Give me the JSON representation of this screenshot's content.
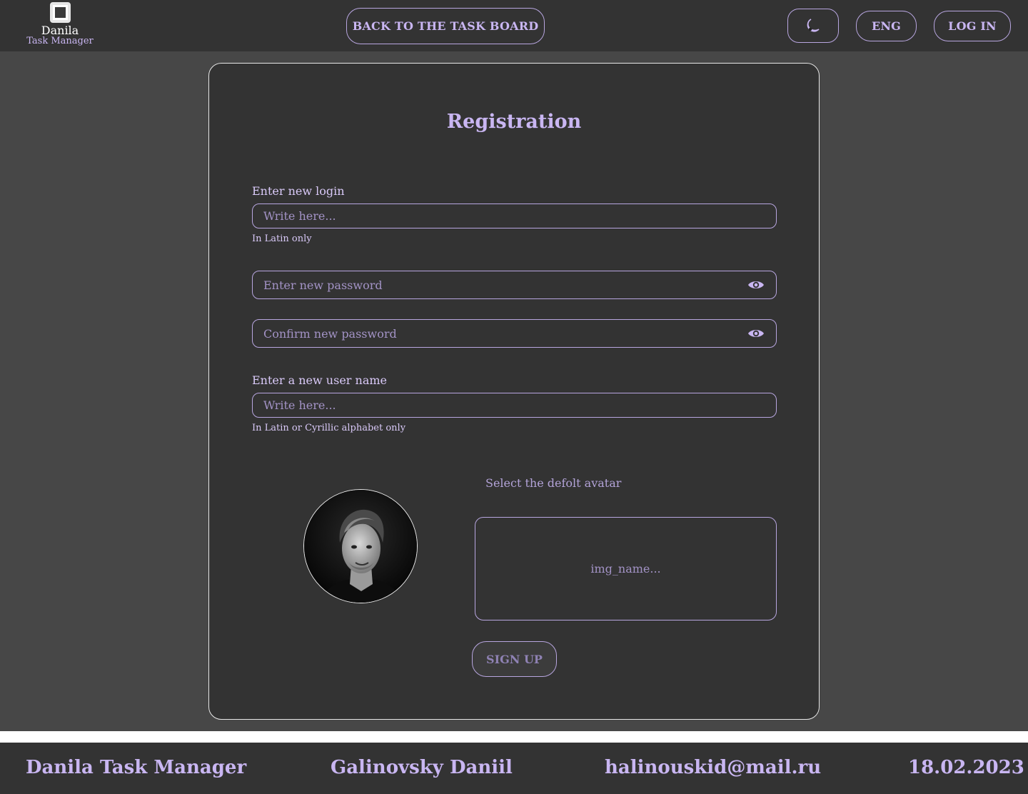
{
  "header": {
    "logo_title": "Danila",
    "logo_subtitle": "Task Manager",
    "back_button": "BACK TO THE TASK BOARD",
    "theme_icon": "moon-icon",
    "lang_button": "ENG",
    "login_button": "LOG IN"
  },
  "form": {
    "title": "Registration",
    "login_label": "Enter new login",
    "login_placeholder": "Write here...",
    "login_hint": "In Latin only",
    "password_placeholder": "Enter new password",
    "confirm_placeholder": "Confirm new password",
    "eye_icon": "eye-icon",
    "username_label": "Enter a new user name",
    "username_placeholder": "Write here...",
    "username_hint": "In Latin or Cyrillic alphabet only",
    "avatar_caption": "Select the defolt avatar",
    "avatar_placeholder": "img_name...",
    "signup_button": "SIGN UP"
  },
  "footer": {
    "app_name": "Danila Task Manager",
    "author": "Galinovsky Daniil",
    "email": "halinouskid@mail.ru",
    "date": "18.02.2023"
  },
  "colors": {
    "accent": "#c9b6f2",
    "border": "#b8a6e0",
    "page_bg": "#474747",
    "panel_bg": "#333333"
  }
}
